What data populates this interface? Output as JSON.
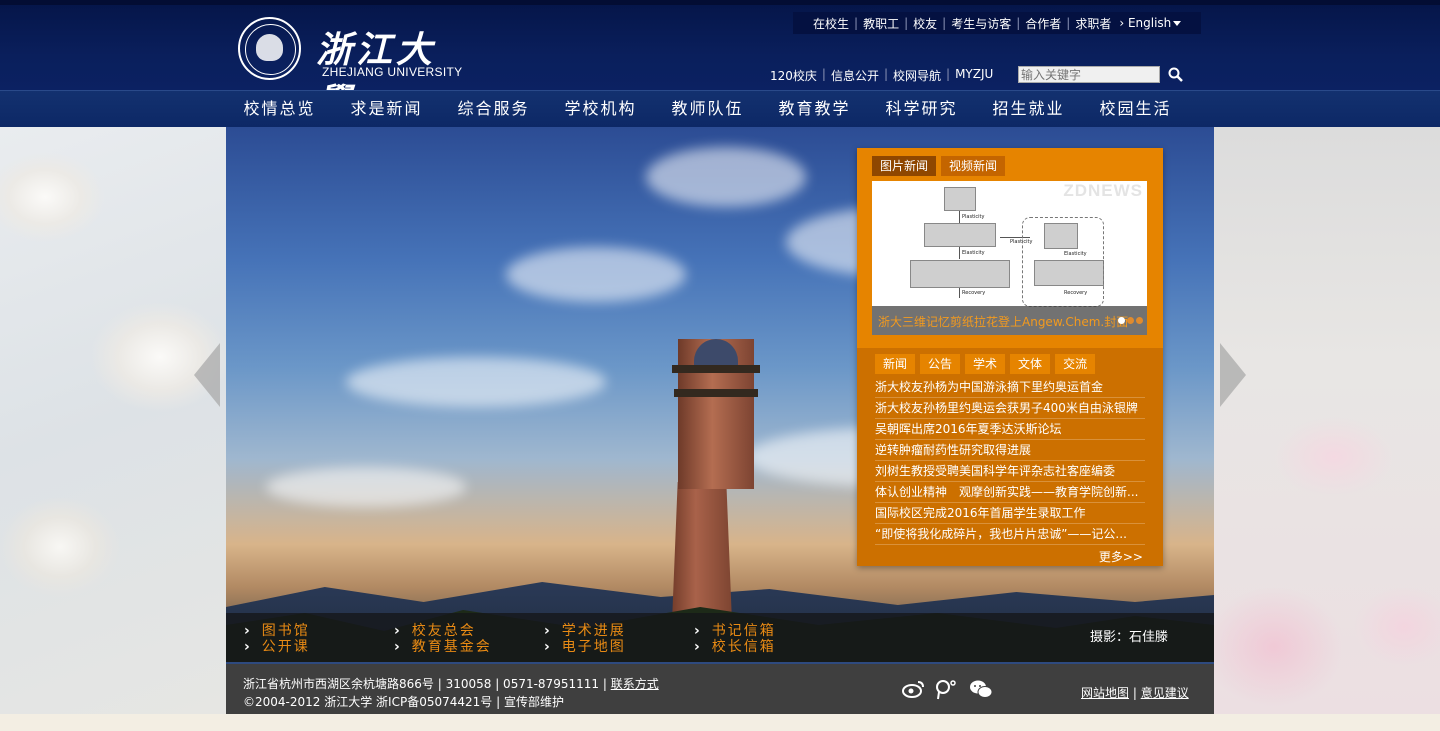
{
  "header": {
    "logo_cn": "浙江大學",
    "logo_en": "ZHEJIANG UNIVERSITY",
    "top_links": [
      "在校生",
      "教职工",
      "校友",
      "考生与访客",
      "合作者",
      "求职者"
    ],
    "language": "English",
    "sub_links": [
      "120校庆",
      "信息公开",
      "校网导航",
      "MYZJU"
    ],
    "search_placeholder": "输入关键字"
  },
  "main_nav": [
    "校情总览",
    "求是新闻",
    "综合服务",
    "学校机构",
    "教师队伍",
    "教育教学",
    "科学研究",
    "招生就业",
    "校园生活"
  ],
  "news_panel": {
    "media_tabs": [
      "图片新闻",
      "视频新闻"
    ],
    "image_watermark": "ZDNEWS",
    "diagram_labels": [
      "Plasticity",
      "Elasticity",
      "Recovery",
      "Plasticity",
      "Elasticity",
      "Recovery"
    ],
    "caption": "浙大三维记忆剪纸拉花登上Angew.Chem.封面",
    "news_tabs": [
      "新闻",
      "公告",
      "学术",
      "文体",
      "交流"
    ],
    "items": [
      "浙大校友孙杨为中国游泳摘下里约奥运首金",
      "浙大校友孙杨里约奥运会获男子400米自由泳银牌",
      "吴朝晖出席2016年夏季达沃斯论坛",
      "逆转肿瘤耐药性研究取得进展",
      "刘树生教授受聘美国科学年评杂志社客座编委",
      "体认创业精神　观摩创新实践——教育学院创新...",
      "国际校区完成2016年首届学生录取工作",
      "“即使将我化成碎片，我也片片忠诚”——记公..."
    ],
    "more": "更多>>"
  },
  "quick_links": [
    "图书馆",
    "公开课",
    "校友总会",
    "教育基金会",
    "学术进展",
    "电子地图",
    "书记信箱",
    "校长信箱"
  ],
  "photo_credit": "摄影：石佳滕",
  "footer": {
    "address": "浙江省杭州市西湖区余杭塘路866号 | 310058 | 0571-87951111  |",
    "contact": "联系方式",
    "copyright": "©2004-2012 浙江大学 浙ICP备05074421号 | 宣传部维护",
    "sitemap": "网站地图",
    "feedback": "意见建议"
  },
  "colors": {
    "header_bg": "#05164a",
    "nav_bg": "#13316f",
    "panel_orange": "#e68400",
    "panel_dark_orange": "#cc7000",
    "link_orange": "#e88a14",
    "footer_bg": "#3f3f3f"
  }
}
